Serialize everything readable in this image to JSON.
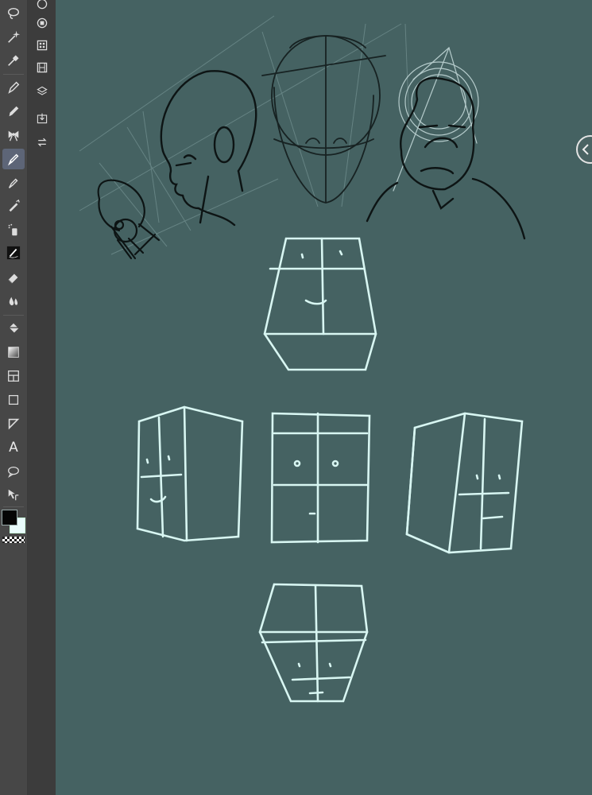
{
  "app": {
    "name": "drawing-app",
    "canvas_color": "#456262",
    "toolbar_color": "#474747",
    "subbar_color": "#3c3c3c"
  },
  "toolbar": {
    "tools": [
      {
        "id": "lasso",
        "icon": "lasso-icon"
      },
      {
        "id": "magic-wand",
        "icon": "magic-wand-icon"
      },
      {
        "id": "eyedropper",
        "icon": "eyedropper-icon"
      },
      {
        "id": "pen",
        "icon": "pen-icon"
      },
      {
        "id": "pencil",
        "icon": "pencil-icon"
      },
      {
        "id": "decoration",
        "icon": "ribbon-icon"
      },
      {
        "id": "brush",
        "icon": "brush-icon",
        "selected": true
      },
      {
        "id": "ink-pen",
        "icon": "ink-pen-icon"
      },
      {
        "id": "airbrush",
        "icon": "airbrush-icon"
      },
      {
        "id": "spray",
        "icon": "spray-icon"
      },
      {
        "id": "correct-line",
        "icon": "correct-line-icon"
      },
      {
        "id": "eraser",
        "icon": "eraser-icon"
      },
      {
        "id": "blend",
        "icon": "blend-icon"
      },
      {
        "id": "fill",
        "icon": "fill-bucket-icon"
      },
      {
        "id": "gradient",
        "icon": "gradient-icon"
      },
      {
        "id": "frame-border",
        "icon": "frame-border-icon"
      },
      {
        "id": "figure",
        "icon": "rectangle-icon"
      },
      {
        "id": "ruler",
        "icon": "ruler-icon"
      },
      {
        "id": "text",
        "icon": "text-icon",
        "label": "A"
      },
      {
        "id": "balloon",
        "icon": "speech-balloon-icon"
      },
      {
        "id": "object",
        "icon": "object-select-icon"
      }
    ],
    "main_color": "#050505",
    "sub_color": "#e9fbfb"
  },
  "subbar": {
    "items": [
      {
        "id": "sub-tool-detail",
        "icon": "sub-tool-icon"
      },
      {
        "id": "navigator",
        "icon": "navigator-icon"
      },
      {
        "id": "material",
        "icon": "material-icon"
      },
      {
        "id": "timeline",
        "icon": "film-icon"
      },
      {
        "id": "layers",
        "icon": "layers-icon"
      },
      {
        "id": "export",
        "icon": "export-icon"
      },
      {
        "id": "history",
        "icon": "history-icon"
      }
    ]
  },
  "panel_toggle": {
    "icon": "chevron-left-icon"
  }
}
